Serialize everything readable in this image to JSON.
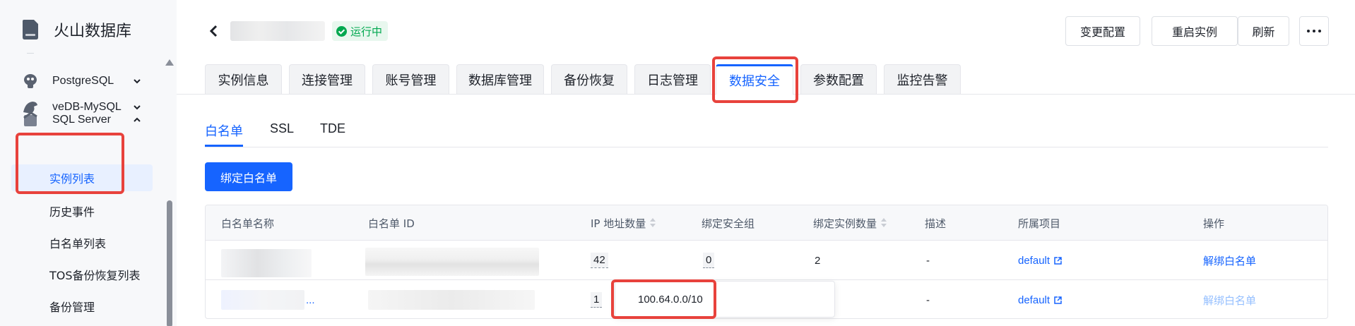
{
  "sidebar": {
    "brand": "火山数据库",
    "groups": [
      {
        "label": "PostgreSQL",
        "icon": "postgresql-icon",
        "expanded": false
      },
      {
        "label": "veDB-MySQL",
        "icon": "vedb-mysql-icon",
        "expanded": false
      },
      {
        "label": "SQL Server",
        "icon": "sql-server-icon",
        "expanded": true
      }
    ],
    "items": [
      {
        "label": "实例列表",
        "active": true
      },
      {
        "label": "历史事件",
        "active": false
      },
      {
        "label": "白名单列表",
        "active": false
      },
      {
        "label": "TOS备份恢复列表",
        "active": false
      },
      {
        "label": "备份管理",
        "active": false
      }
    ]
  },
  "header": {
    "status": "运行中",
    "buttons": [
      "变更配置",
      "重启实例",
      "刷新"
    ],
    "more_icon": "more-icon"
  },
  "main_tabs": [
    {
      "label": "实例信息",
      "active": false
    },
    {
      "label": "连接管理",
      "active": false
    },
    {
      "label": "账号管理",
      "active": false
    },
    {
      "label": "数据库管理",
      "active": false
    },
    {
      "label": "备份恢复",
      "active": false
    },
    {
      "label": "日志管理",
      "active": false
    },
    {
      "label": "数据安全",
      "active": true
    },
    {
      "label": "参数配置",
      "active": false
    },
    {
      "label": "监控告警",
      "active": false
    }
  ],
  "sub_tabs": [
    {
      "label": "白名单",
      "active": true
    },
    {
      "label": "SSL",
      "active": false
    },
    {
      "label": "TDE",
      "active": false
    }
  ],
  "bind_button": "绑定白名单",
  "table": {
    "columns": [
      "白名单名称",
      "白名单 ID",
      "IP 地址数量",
      "绑定安全组",
      "绑定实例数量",
      "描述",
      "所属项目",
      "操作"
    ],
    "rows": [
      {
        "ip_count": "42",
        "security_groups": "0",
        "instance_count": "2",
        "description": "-",
        "project": "default",
        "action": "解绑白名单",
        "action_enabled": true
      },
      {
        "name_suffix": "...",
        "ip_count": "1",
        "security_groups": "",
        "instance_count": "",
        "description": "-",
        "project": "default",
        "action": "解绑白名单",
        "action_enabled": false
      }
    ]
  },
  "popover": {
    "ip": "100.64.0.0/10"
  },
  "colors": {
    "primary": "#1664ff",
    "success": "#00a84f",
    "highlight": "#e8423c"
  }
}
